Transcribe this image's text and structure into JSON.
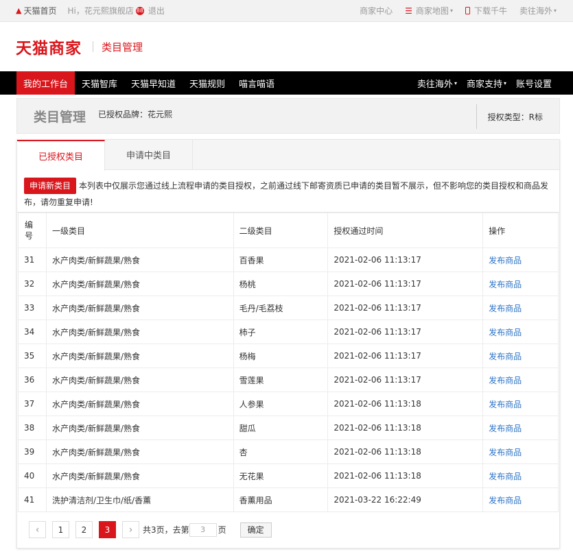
{
  "topbar": {
    "home": "天猫首页",
    "greeting": "Hi，花元熙旗舰店",
    "badge": "88",
    "logout": "退出",
    "merchant_center": "商家中心",
    "merchant_map": "商家地图",
    "download": "下载千牛",
    "sell_abroad": "卖往海外"
  },
  "logo": {
    "name": "天猫商家",
    "sub": "类目管理"
  },
  "nav": {
    "left": [
      "我的工作台",
      "天猫智库",
      "天猫早知道",
      "天猫规则",
      "喵言喵语"
    ],
    "right": [
      "卖往海外",
      "商家支持",
      "账号设置"
    ]
  },
  "titlebox": {
    "title": "类目管理",
    "brand": "已授权品牌：花元熙",
    "auth_type": "授权类型：R标"
  },
  "tabs": [
    "已授权类目",
    "申请中类目"
  ],
  "notice": {
    "button": "申请新类目",
    "text": "本列表中仅展示您通过线上流程申请的类目授权，之前通过线下邮寄资质已申请的类目暂不展示，但不影响您的类目授权和商品发布，请勿重复申请!"
  },
  "table": {
    "headers": [
      "编号",
      "一级类目",
      "二级类目",
      "授权通过时间",
      "操作"
    ],
    "rows": [
      {
        "id": "31",
        "cat1": "水产肉类/新鲜蔬果/熟食",
        "cat2": "百香果",
        "time": "2021-02-06 11:13:17",
        "op": "发布商品"
      },
      {
        "id": "32",
        "cat1": "水产肉类/新鲜蔬果/熟食",
        "cat2": "杨桃",
        "time": "2021-02-06 11:13:17",
        "op": "发布商品"
      },
      {
        "id": "33",
        "cat1": "水产肉类/新鲜蔬果/熟食",
        "cat2": "毛丹/毛荔枝",
        "time": "2021-02-06 11:13:17",
        "op": "发布商品"
      },
      {
        "id": "34",
        "cat1": "水产肉类/新鲜蔬果/熟食",
        "cat2": "柿子",
        "time": "2021-02-06 11:13:17",
        "op": "发布商品"
      },
      {
        "id": "35",
        "cat1": "水产肉类/新鲜蔬果/熟食",
        "cat2": "杨梅",
        "time": "2021-02-06 11:13:17",
        "op": "发布商品"
      },
      {
        "id": "36",
        "cat1": "水产肉类/新鲜蔬果/熟食",
        "cat2": "雪莲果",
        "time": "2021-02-06 11:13:17",
        "op": "发布商品"
      },
      {
        "id": "37",
        "cat1": "水产肉类/新鲜蔬果/熟食",
        "cat2": "人参果",
        "time": "2021-02-06 11:13:18",
        "op": "发布商品"
      },
      {
        "id": "38",
        "cat1": "水产肉类/新鲜蔬果/熟食",
        "cat2": "甜瓜",
        "time": "2021-02-06 11:13:18",
        "op": "发布商品"
      },
      {
        "id": "39",
        "cat1": "水产肉类/新鲜蔬果/熟食",
        "cat2": "杏",
        "time": "2021-02-06 11:13:18",
        "op": "发布商品"
      },
      {
        "id": "40",
        "cat1": "水产肉类/新鲜蔬果/熟食",
        "cat2": "无花果",
        "time": "2021-02-06 11:13:18",
        "op": "发布商品"
      },
      {
        "id": "41",
        "cat1": "洗护清洁剂/卫生巾/纸/香薰",
        "cat2": "香薰用品",
        "time": "2021-03-22 16:22:49",
        "op": "发布商品"
      }
    ]
  },
  "pager": {
    "pages": [
      "1",
      "2",
      "3"
    ],
    "current": "3",
    "total_text": "共3页，去第",
    "input_value": "3",
    "page_suffix": "页",
    "confirm": "确定"
  },
  "colors": {
    "brand_red": "#d9161c",
    "link_blue": "#2d74c6"
  }
}
